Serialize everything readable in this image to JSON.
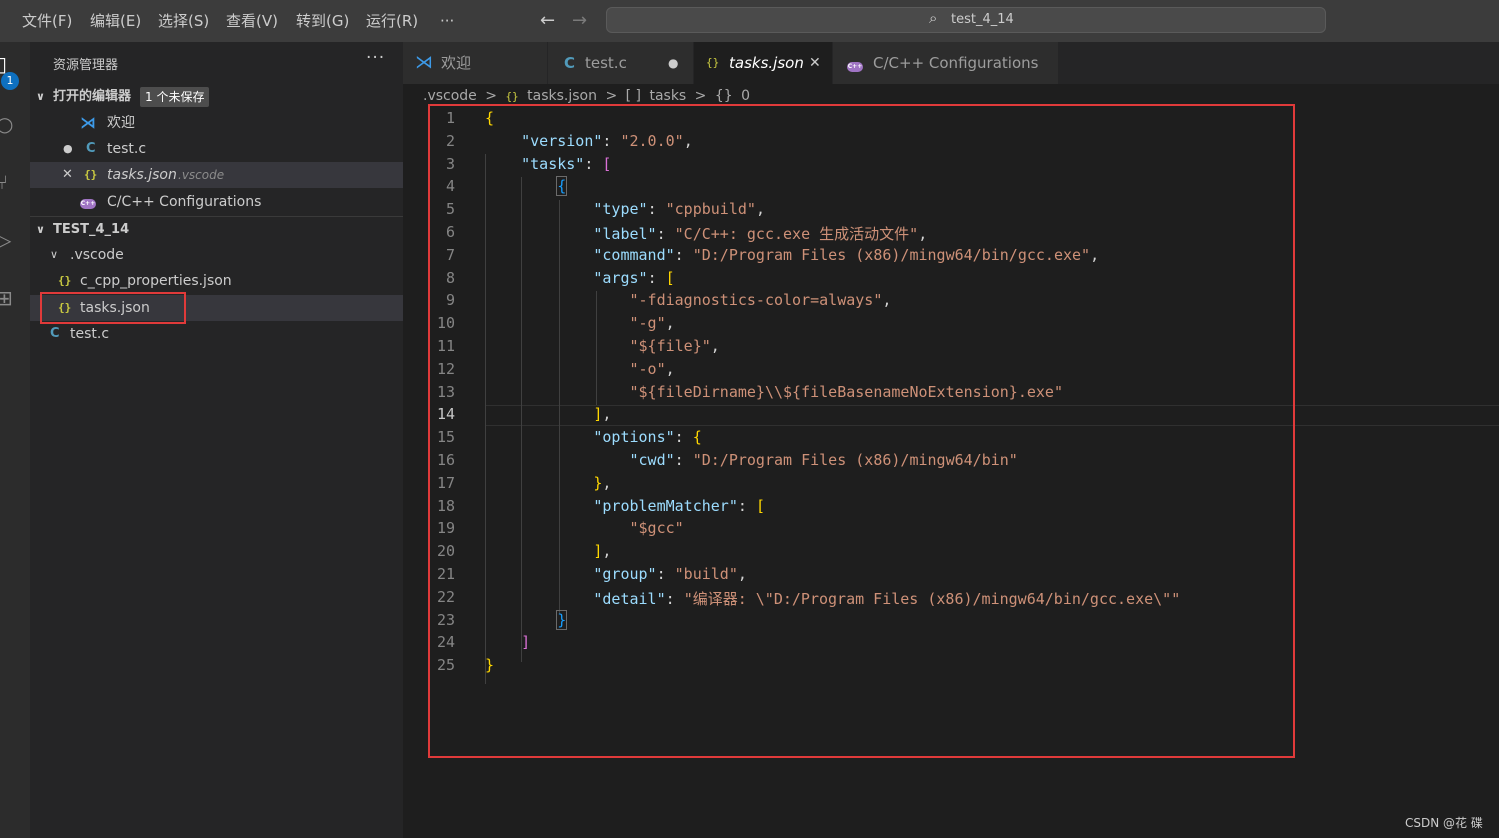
{
  "menu": [
    "文件(F)",
    "编辑(E)",
    "选择(S)",
    "查看(V)",
    "转到(G)",
    "运行(R)",
    "···"
  ],
  "search": {
    "text": "test_4_14"
  },
  "activity": {
    "badge": "1"
  },
  "sidebar": {
    "title": "资源管理器",
    "more": "···",
    "open_editors": {
      "label": "打开的编辑器",
      "unsaved": "1 个未保存",
      "items": [
        {
          "name": "欢迎",
          "icon": "vscode-icon",
          "marker": ""
        },
        {
          "name": "test.c",
          "icon": "c-file-icon",
          "marker": "●"
        },
        {
          "name": "tasks.json",
          "desc": ".vscode",
          "icon": "json-icon",
          "marker": "✕"
        },
        {
          "name": "C/C++ Configurations",
          "icon": "cpp-icon",
          "marker": ""
        }
      ]
    },
    "folder": {
      "label": "TEST_4_14",
      "subfolder": ".vscode",
      "files": [
        "c_cpp_properties.json",
        "tasks.json",
        "test.c"
      ]
    }
  },
  "tabs": [
    {
      "label": "欢迎",
      "icon": "vscode-icon"
    },
    {
      "label": "test.c",
      "icon": "c-file-icon",
      "indicator": "●"
    },
    {
      "label": "tasks.json",
      "icon": "json-icon",
      "indicator": "✕"
    },
    {
      "label": "C/C++ Configurations",
      "icon": "cpp-icon"
    }
  ],
  "breadcrumbs": [
    ".vscode",
    ">",
    "{}",
    "tasks.json",
    ">",
    "[ ]",
    "tasks",
    ">",
    "{}",
    "0"
  ],
  "code": {
    "line_numbers": [
      "1",
      "2",
      "3",
      "4",
      "5",
      "6",
      "7",
      "8",
      "9",
      "10",
      "11",
      "12",
      "13",
      "14",
      "15",
      "16",
      "17",
      "18",
      "19",
      "20",
      "21",
      "22",
      "23",
      "24",
      "25"
    ],
    "current_line": "14",
    "lines": {
      "l2": [
        "\"version\"",
        ": ",
        "\"2.0.0\"",
        ","
      ],
      "l3": [
        "\"tasks\"",
        ": ",
        "["
      ],
      "l5": [
        "\"type\"",
        ": ",
        "\"cppbuild\"",
        ","
      ],
      "l6": [
        "\"label\"",
        ": ",
        "\"C/C++: gcc.exe 生成活动文件\"",
        ","
      ],
      "l7": [
        "\"command\"",
        ": ",
        "\"D:/Program Files (x86)/mingw64/bin/gcc.exe\"",
        ","
      ],
      "l8": [
        "\"args\"",
        ": ",
        "["
      ],
      "l9": [
        "\"-fdiagnostics-color=always\"",
        ","
      ],
      "l10": [
        "\"-g\"",
        ","
      ],
      "l11": [
        "\"${file}\"",
        ","
      ],
      "l12": [
        "\"-o\"",
        ","
      ],
      "l13": [
        "\"${fileDirname}\\\\${fileBasenameNoExtension}.exe\""
      ],
      "l14": [
        "]",
        ","
      ],
      "l15": [
        "\"options\"",
        ": ",
        "{"
      ],
      "l16": [
        "\"cwd\"",
        ": ",
        "\"D:/Program Files (x86)/mingw64/bin\""
      ],
      "l17": [
        "}",
        ","
      ],
      "l18": [
        "\"problemMatcher\"",
        ": ",
        "["
      ],
      "l19": [
        "\"$gcc\""
      ],
      "l20": [
        "]",
        ","
      ],
      "l21": [
        "\"group\"",
        ": ",
        "\"build\"",
        ","
      ],
      "l22": [
        "\"detail\"",
        ": ",
        "\"编译器: \\\"D:/Program Files (x86)/mingw64/bin/gcc.exe\\\"\""
      ],
      "brace_open": "{",
      "brace_close": "}",
      "bracket_close": "]"
    }
  },
  "watermark": "CSDN @花 碟",
  "colors": {
    "highlight_box": "#e03a3a",
    "badge": "#0e70c0"
  }
}
